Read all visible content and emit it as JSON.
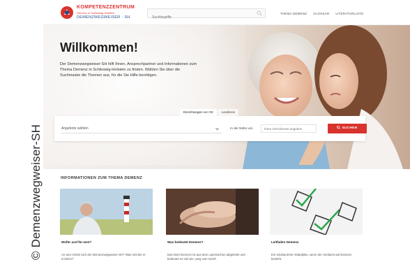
{
  "copyright": "© Demenzwegweiser-SH",
  "header": {
    "logo_line1": "KOMPETENZZENTRUM",
    "logo_line2": "Demenz in Schleswig-Holstein",
    "logo_line3": "DEMENZWEGWEISER · SH",
    "search_placeholder": "Suchbegriffe",
    "nav": [
      "THEMA DEMENZ",
      "GLOSSAR",
      "LITERATURLISTE"
    ]
  },
  "hero": {
    "title": "Willkommen!",
    "intro": "Der Demenzwegweiser-SH hilft Ihnen, Ansprechpartner und Informationen zum Thema Demenz in Schleswig-Holstein zu finden. Wählen Sie über die Suchmaske die Themen aus, für die Sie Hilfe benötigen."
  },
  "search_panel": {
    "tabs": [
      "Einrichtungen vor Ort",
      "Landkreis"
    ],
    "select_value": "Angebote wählen",
    "near_label": "In der Nähe von",
    "near_placeholder": "Ihren Ort/Adresse angeben",
    "button": "SUCHEN"
  },
  "info": {
    "title": "INFORMATIONEN ZUM THEMA DEMENZ",
    "cards": [
      {
        "title": "Wofür und für wen?",
        "text": "An wen richtet sich der Demenzwegweiser-SH? Was möchte er erzielen?"
      },
      {
        "title": "Was bedeutet Demenz?",
        "text": "Das Wort Demenz ist aus dem Lateinischen abgeleitet und bedeutet so viel wie „weg vom Geist“."
      },
      {
        "title": "Leitfaden Demenz",
        "text": "Ein strukturierter Ablaufplan, wenn der Verdacht auf Demenz besteht."
      }
    ]
  },
  "colors": {
    "accent": "#d8332c",
    "brand_blue": "#1f4e8c"
  }
}
